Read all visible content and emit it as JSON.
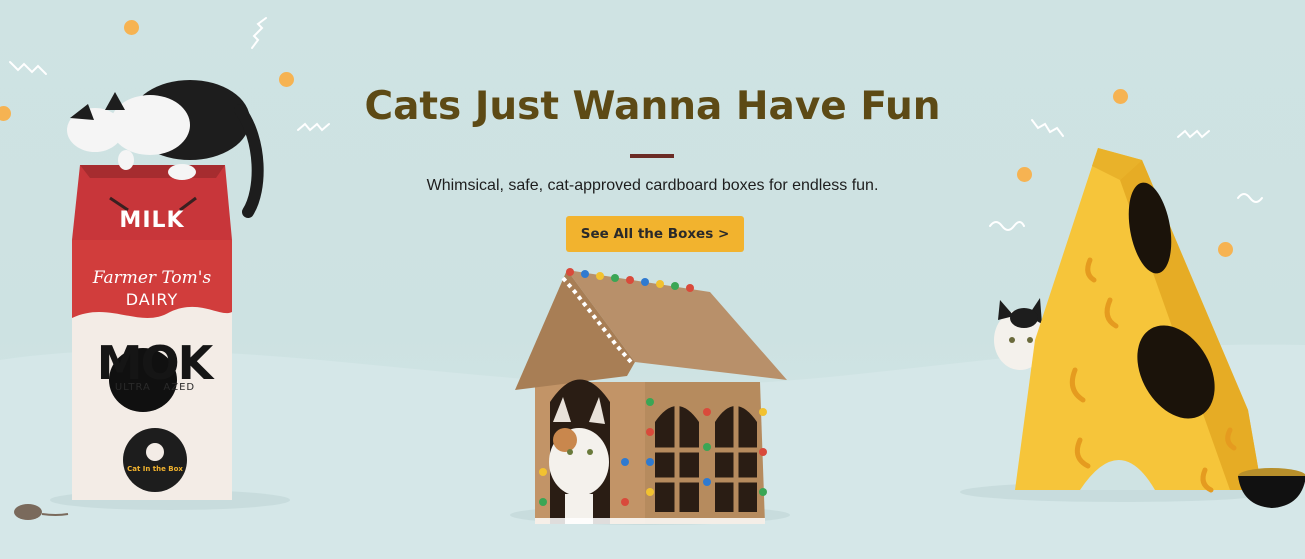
{
  "hero": {
    "title": "Cats Just Wanna Have Fun",
    "subtitle": "Whimsical, safe,  cat-approved cardboard boxes for endless fun.",
    "cta_label": "See All the Boxes >"
  },
  "milk_box": {
    "label_top": "MILK",
    "brand_line1": "Farmer Tom's",
    "brand_line2": "DAIRY",
    "big_word": "MOK",
    "small_line": "ULTRA   AZED",
    "logo_text": "Cat In the Box"
  },
  "colors": {
    "background": "#cfe3e3",
    "title": "#5d4a15",
    "divider": "#6b2b25",
    "button": "#f2b32e",
    "confetti": "#f6b352",
    "milk_red": "#d13d3c",
    "cheese_yellow": "#f6c53a",
    "cardboard": "#b68b5e"
  }
}
